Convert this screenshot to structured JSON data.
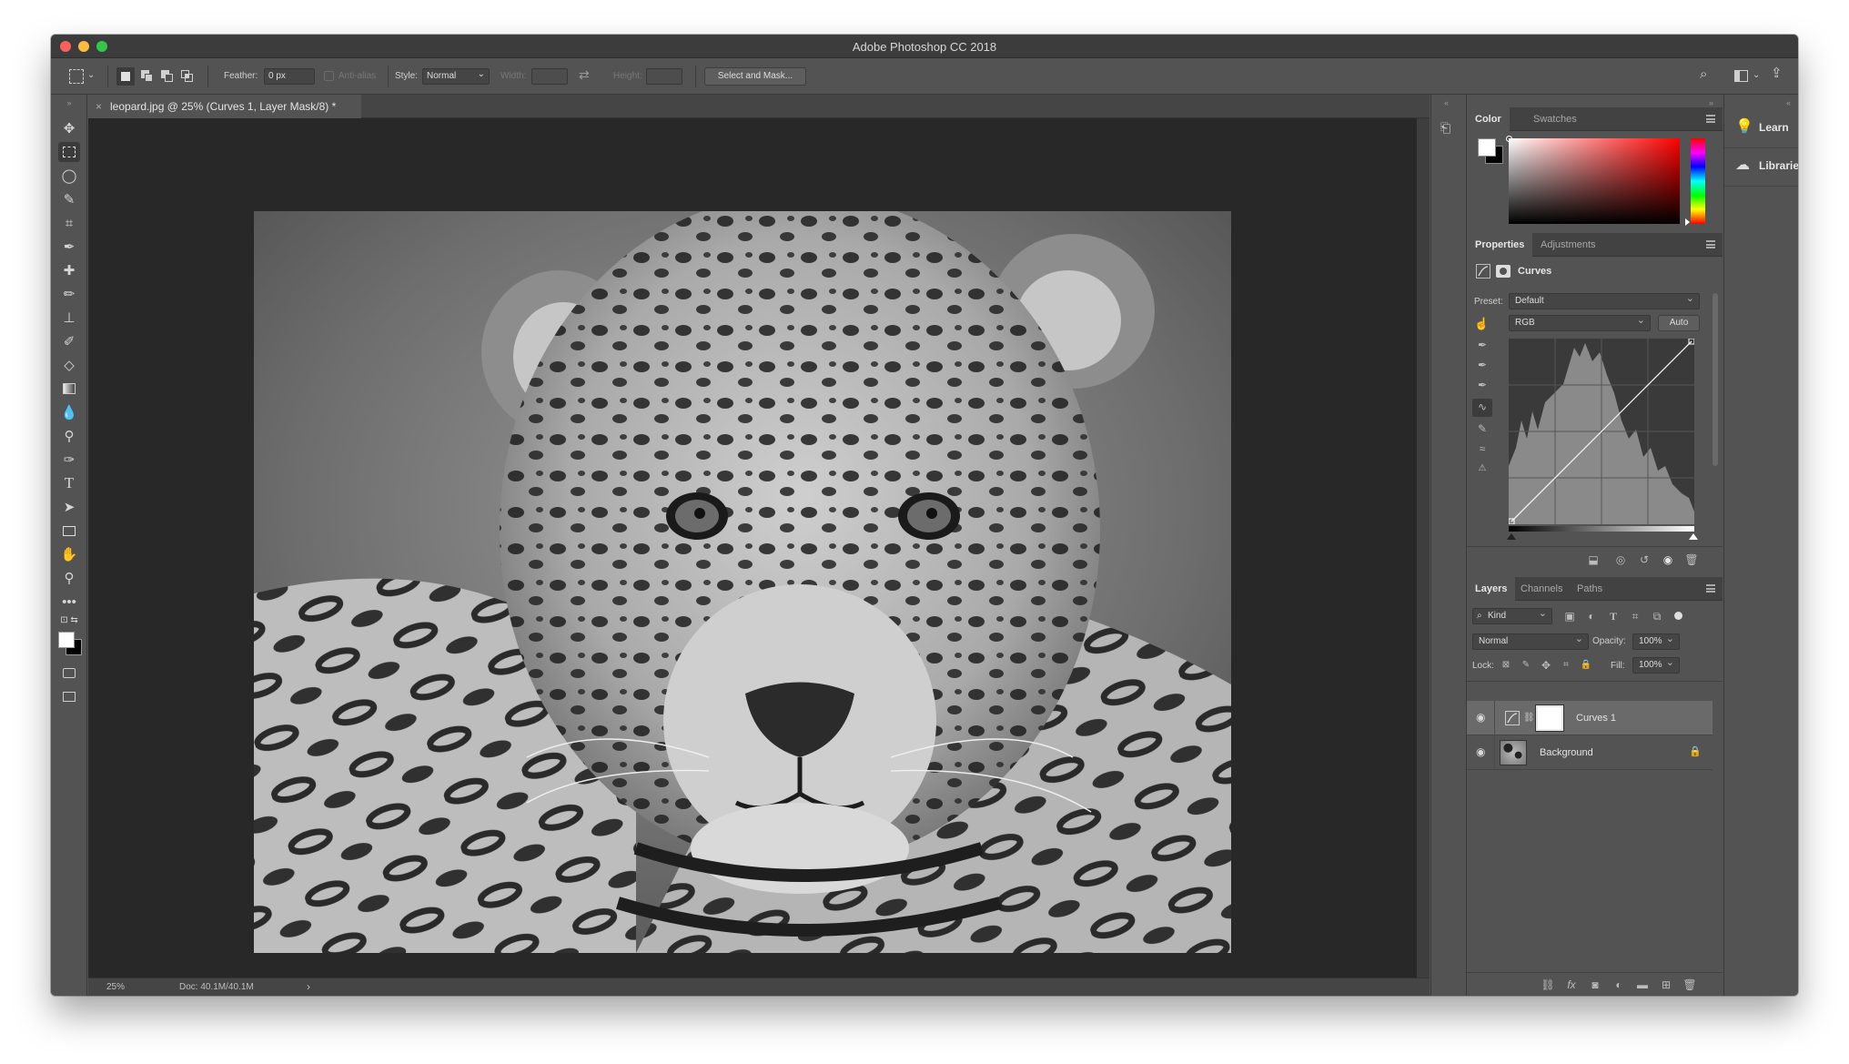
{
  "app": {
    "title": "Adobe Photoshop CC 2018"
  },
  "options_bar": {
    "feather_label": "Feather:",
    "feather_value": "0 px",
    "anti_alias_label": "Anti-alias",
    "style_label": "Style:",
    "style_value": "Normal",
    "width_label": "Width:",
    "height_label": "Height:",
    "select_mask_button": "Select and Mask..."
  },
  "document": {
    "tab_title": "leopard.jpg @ 25% (Curves 1, Layer Mask/8) *",
    "tab_close": "×",
    "status_zoom": "25%",
    "status_doc": "Doc: 40.1M/40.1M",
    "status_arrow": "›"
  },
  "color_panel": {
    "tabs": [
      "Color",
      "Swatches"
    ],
    "foreground": "#ffffff",
    "background": "#000000",
    "hue_color": "#ff0000"
  },
  "properties_panel": {
    "tabs": [
      "Properties",
      "Adjustments"
    ],
    "adjustment_title": "Curves",
    "preset_label": "Preset:",
    "preset_value": "Default",
    "channel_value": "RGB",
    "auto_button": "Auto"
  },
  "layers_panel": {
    "tabs": [
      "Layers",
      "Channels",
      "Paths"
    ],
    "kind_filter": "Kind",
    "blend_mode": "Normal",
    "opacity_label": "Opacity:",
    "opacity_value": "100%",
    "lock_label": "Lock:",
    "fill_label": "Fill:",
    "fill_value": "100%",
    "layers": [
      {
        "name": "Curves 1",
        "selected": true
      },
      {
        "name": "Background",
        "selected": false
      }
    ]
  },
  "right_column": {
    "learn_label": "Learn",
    "libraries_label": "Libraries"
  }
}
